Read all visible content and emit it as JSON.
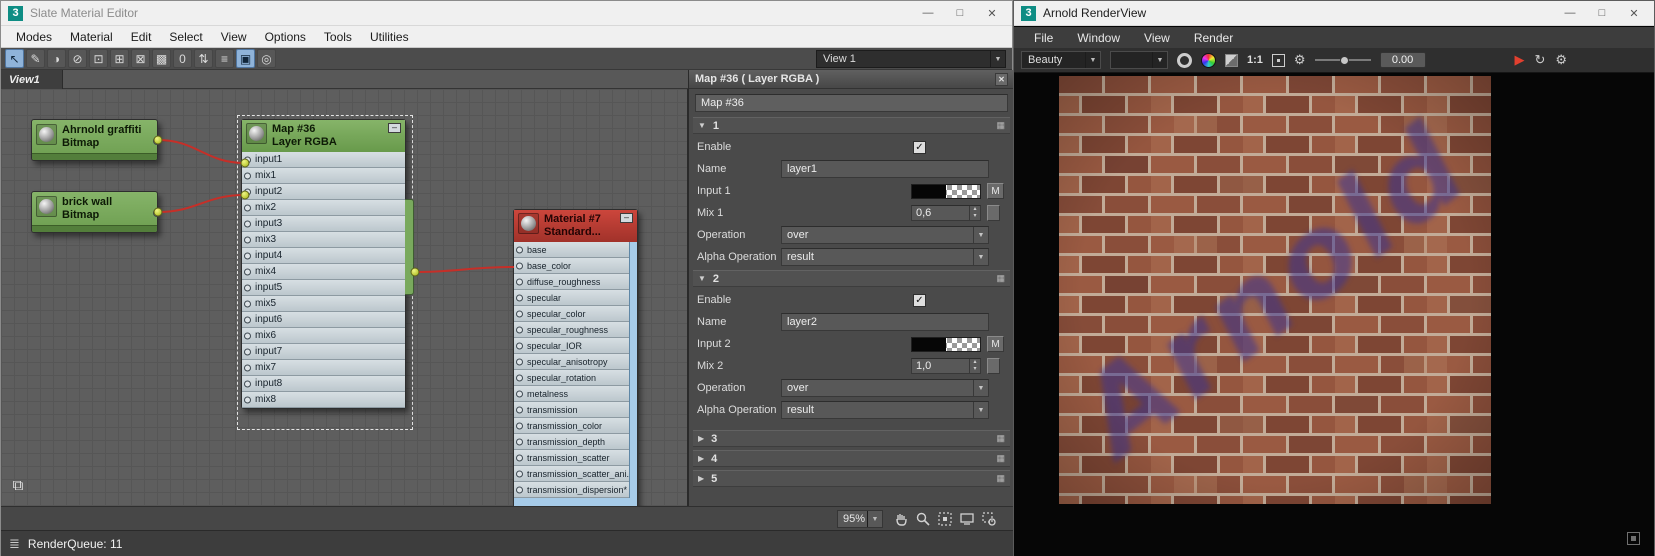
{
  "slate": {
    "title": "Slate Material Editor",
    "controls": {
      "minimize": "—",
      "maximize": "□",
      "close": "✕"
    },
    "menus": [
      "Modes",
      "Material",
      "Edit",
      "Select",
      "View",
      "Options",
      "Tools",
      "Utilities"
    ],
    "toolbar": {
      "icons": [
        {
          "name": "select-tool-icon",
          "glyph": "↖",
          "active": true
        },
        {
          "name": "pick-material-icon",
          "glyph": "✎"
        },
        {
          "name": "sample-slot-icon",
          "glyph": "◑"
        },
        {
          "name": "delete-selected-icon",
          "glyph": "⊘"
        },
        {
          "name": "move-children-icon",
          "glyph": "⊡"
        },
        {
          "name": "hide-unused-nodeslots-icon",
          "glyph": "⊞"
        },
        {
          "name": "show-shaded-material-icon",
          "glyph": "⊠"
        },
        {
          "name": "show-background-icon",
          "glyph": "▩"
        },
        {
          "name": "show-material-id-icon",
          "glyph": "0"
        },
        {
          "name": "layout-all-icon",
          "glyph": "⇅"
        },
        {
          "name": "layout-children-icon",
          "glyph": "≡"
        },
        {
          "name": "select-by-material-icon",
          "glyph": "▣",
          "active": true
        },
        {
          "name": "zoom-preview-icon",
          "glyph": "◎"
        }
      ],
      "view_selector": "View 1"
    },
    "tab": "View1",
    "nodes": {
      "bitmap1": {
        "title": "Ahrnold graffiti",
        "subtitle": "Bitmap"
      },
      "bitmap2": {
        "title": "brick wall",
        "subtitle": "Bitmap"
      },
      "layer": {
        "title": "Map #36",
        "subtitle": "Layer RGBA",
        "slots": [
          "input1",
          "mix1",
          "input2",
          "mix2",
          "input3",
          "mix3",
          "input4",
          "mix4",
          "input5",
          "mix5",
          "input6",
          "mix6",
          "input7",
          "mix7",
          "input8",
          "mix8"
        ]
      },
      "material": {
        "title": "Material #7",
        "subtitle": "Standard...",
        "slots": [
          "base",
          "base_color",
          "diffuse_roughness",
          "specular",
          "specular_color",
          "specular_roughness",
          "specular_IOR",
          "specular_anisotropy",
          "specular_rotation",
          "metalness",
          "transmission",
          "transmission_color",
          "transmission_depth",
          "transmission_scatter",
          "transmission_scatter_ani...",
          "transmission_dispersion*"
        ]
      }
    },
    "panel": {
      "header": "Map #36  ( Layer RGBA )",
      "name_value": "Map #36",
      "m_button": "M",
      "labels": {
        "enable": "Enable",
        "name": "Name",
        "operation": "Operation",
        "alpha_operation": "Alpha Operation"
      },
      "sections": [
        {
          "id": "1",
          "name": "layer1",
          "input_label": "Input 1",
          "mix_label": "Mix 1",
          "mix_value": "0,6",
          "operation": "over",
          "alpha_operation": "result"
        },
        {
          "id": "2",
          "name": "layer2",
          "input_label": "Input 2",
          "mix_label": "Mix 2",
          "mix_value": "1,0",
          "operation": "over",
          "alpha_operation": "result"
        },
        {
          "id": "3"
        },
        {
          "id": "4"
        },
        {
          "id": "5"
        }
      ]
    },
    "zoom": "95%",
    "status": "RenderQueue: 11"
  },
  "arnold": {
    "title": "Arnold RenderView",
    "controls": {
      "minimize": "—",
      "maximize": "□",
      "close": "✕"
    },
    "menus": [
      "File",
      "Window",
      "View",
      "Render"
    ],
    "toolbar": {
      "aov": "Beauty",
      "camera": "",
      "ratio": "1:1",
      "exposure": "0.00"
    },
    "render": {
      "graffiti_text": "Arnold"
    }
  },
  "accent_colors": {
    "wire": "#c62f28",
    "node_green": "#76a55a",
    "node_red": "#b5392f",
    "node_blue": "#a6cbe8",
    "connector_dot": "#c3cf3f"
  }
}
